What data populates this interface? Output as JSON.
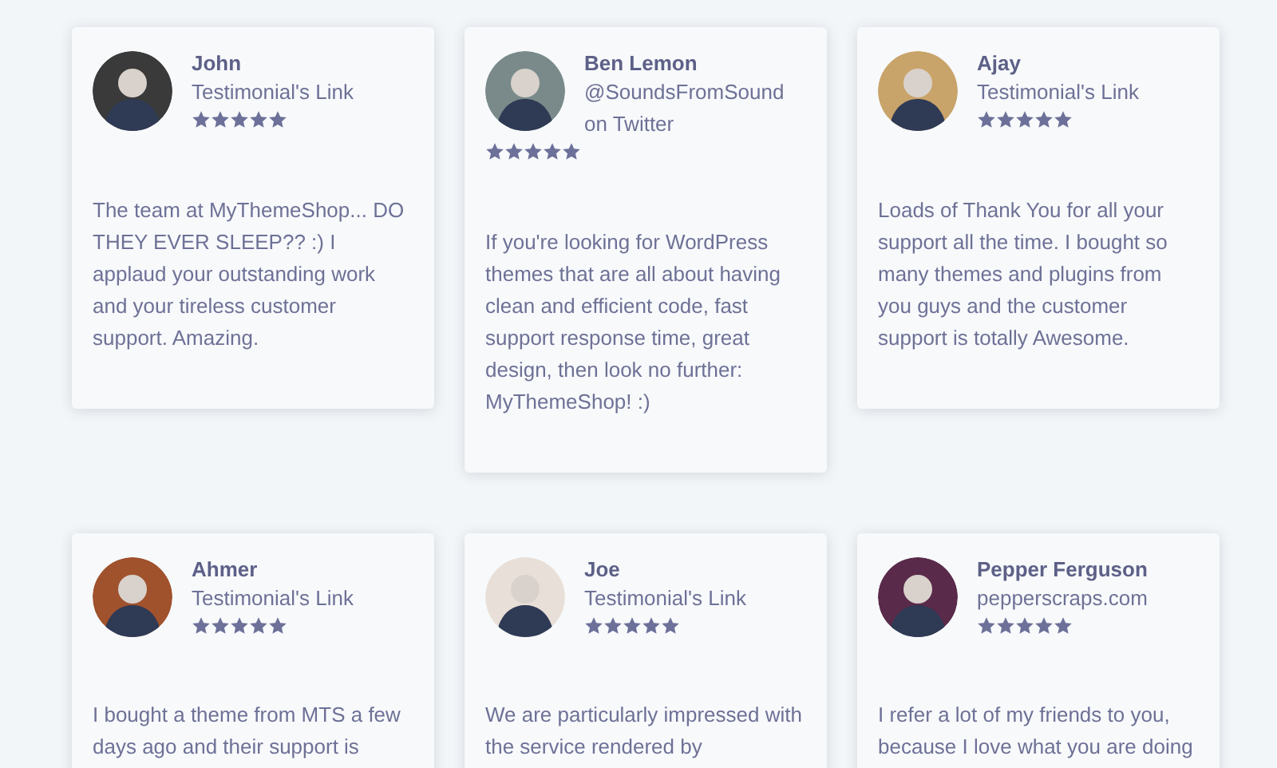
{
  "testimonials": [
    {
      "name": "John",
      "link": "Testimonial's Link",
      "stars": 5,
      "quote": "The team at MyThemeShop... DO THEY EVER SLEEP?? :) I applaud your outstanding work and your tireless customer support. Amazing."
    },
    {
      "name": "Ben Lemon",
      "link": "@SoundsFromSound on Twitter",
      "stars": 5,
      "quote": "If you're looking for WordPress themes that are all about having clean and efficient code, fast support response time, great design, then look no further: MyThemeShop! :)"
    },
    {
      "name": "Ajay",
      "link": "Testimonial's Link",
      "stars": 5,
      "quote": "Loads of Thank You for all your support all the time. I bought so many themes and plugins from you guys and the customer support is totally Awesome."
    },
    {
      "name": "Ahmer",
      "link": "Testimonial's Link",
      "stars": 5,
      "quote": "I bought a theme from MTS a few days ago and their support is"
    },
    {
      "name": "Joe",
      "link": "Testimonial's Link",
      "stars": 5,
      "quote": "We are particularly impressed with the service rendered by"
    },
    {
      "name": "Pepper Ferguson",
      "link": "pepperscraps.com",
      "stars": 5,
      "quote": "I refer a lot of my friends to you, because I love what you are doing"
    }
  ]
}
